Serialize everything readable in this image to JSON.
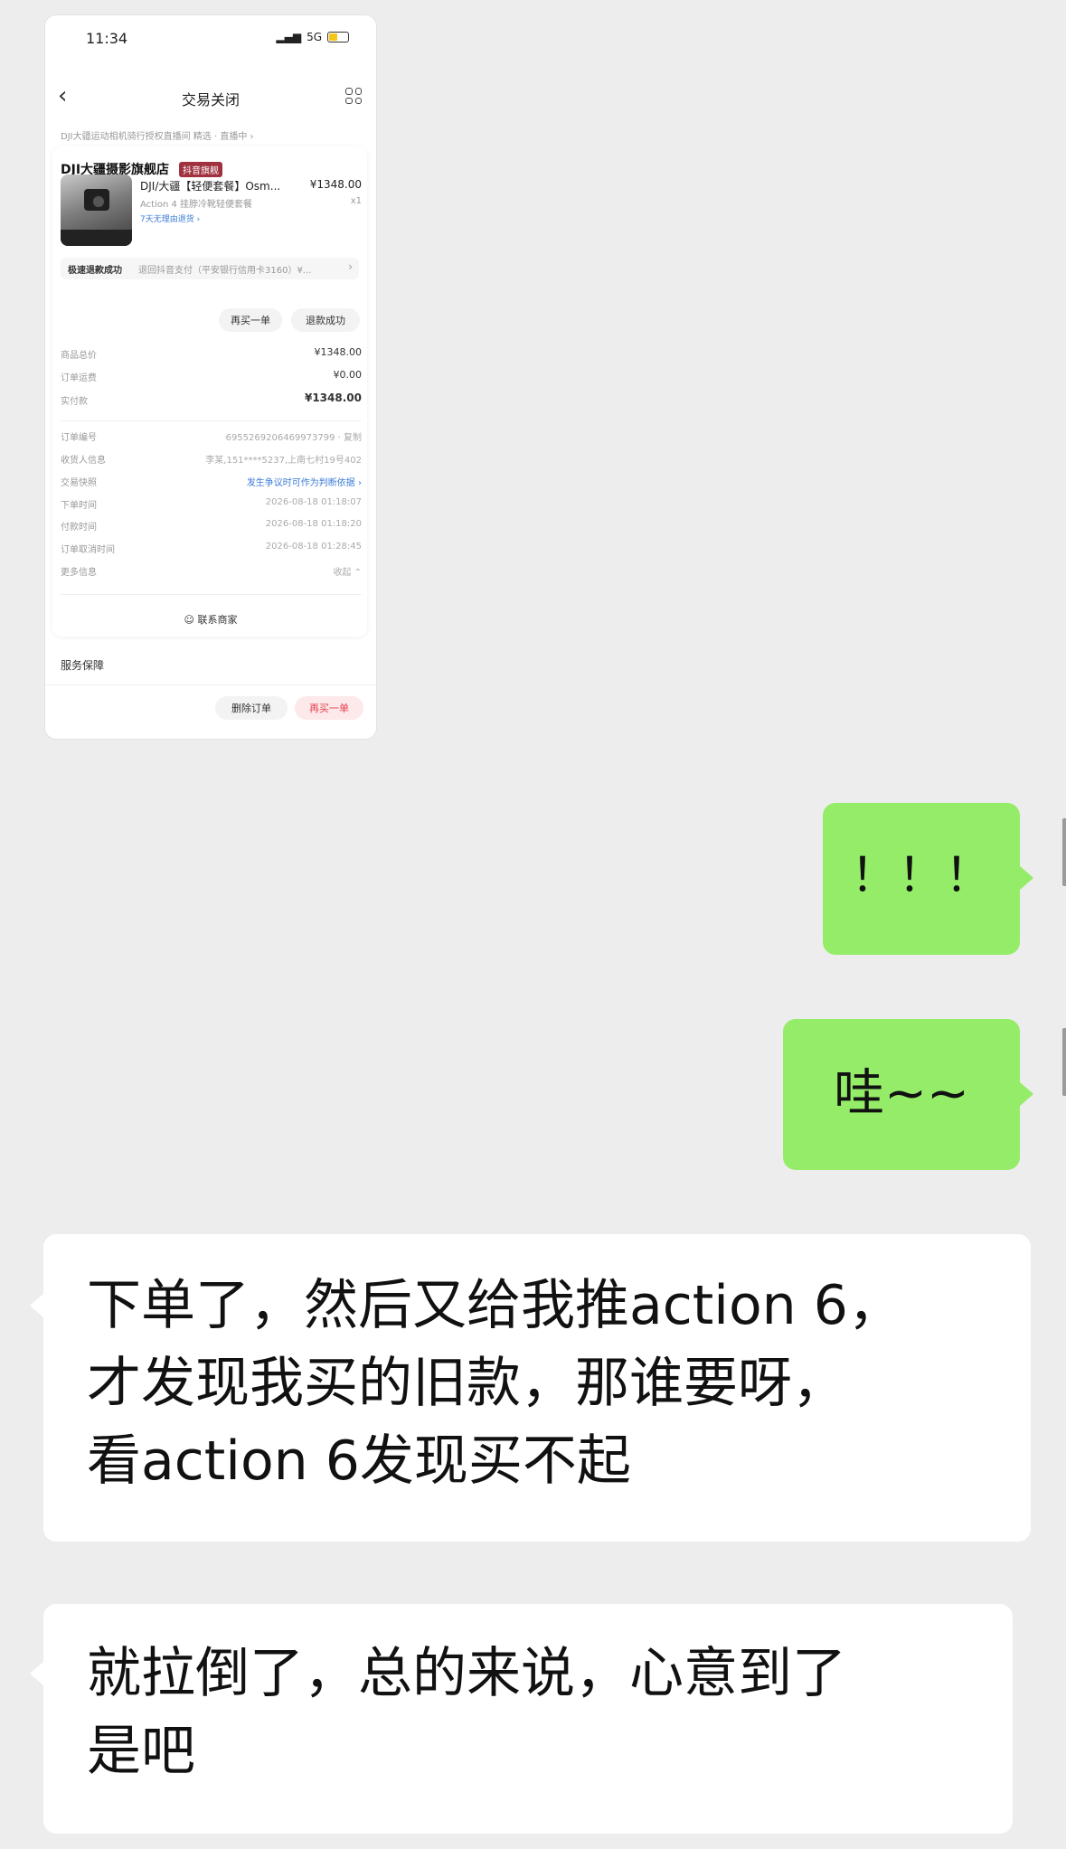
{
  "screenshot": {
    "status_bar": {
      "time": "11:34",
      "network": "5G"
    },
    "nav": {
      "title": "交易关闭"
    },
    "breadcrumb": "DJI大疆运动相机骑行授权直播间 精选 · 直播中 ›",
    "store": {
      "name": "DJI大疆摄影旗舰店",
      "badge": "抖音旗舰"
    },
    "product": {
      "name": "DJI/大疆【轻便套餐】Osm...",
      "price": "¥1348.00",
      "spec": "Action 4 挂脖冷靴轻便套餐",
      "quantity": "x1",
      "tag": "7天无理由退货 ›"
    },
    "refund": {
      "label": "极速退款成功",
      "text": "退回抖音支付（平安银行信用卡3160）¥...",
      "arrow": "›"
    },
    "buttons": {
      "buy_again": "再买一单",
      "refund_success": "退款成功",
      "delete_order": "删除订单",
      "buy_again_bottom": "再买一单"
    },
    "price_rows": [
      {
        "label": "商品总价",
        "value": "¥1348.00"
      },
      {
        "label": "订单运费",
        "value": "¥0.00"
      },
      {
        "label": "实付款",
        "value": "¥1348.00"
      }
    ],
    "info_rows": [
      {
        "label": "订单编号",
        "value": "6955269206469973799 · 复制"
      },
      {
        "label": "收货人信息",
        "value": "李某,151****5237,上南七村19号402"
      },
      {
        "label": "交易快照",
        "value": "发生争议时可作为判断依据 ›"
      },
      {
        "label": "下单时间",
        "value": "2026-08-18 01:18:07"
      },
      {
        "label": "付款时间",
        "value": "2026-08-18 01:18:20"
      },
      {
        "label": "订单取消时间",
        "value": "2026-08-18 01:28:45"
      },
      {
        "label": "更多信息",
        "value": "收起 ⌃"
      }
    ],
    "contact": "联系商家",
    "service": "服务保障"
  },
  "messages": [
    {
      "side": "right",
      "lines": [
        "！！！"
      ]
    },
    {
      "side": "right",
      "lines": [
        "哇~~"
      ]
    },
    {
      "side": "left",
      "lines": [
        "下单了，然后又给我推action 6，",
        "才发现我买的旧款，那谁要呀，",
        "看action 6发现买不起"
      ]
    },
    {
      "side": "left",
      "lines": [
        "就拉倒了，总的来说，心意到了",
        "是吧"
      ]
    }
  ],
  "colors": {
    "outgoing_bubble": "#95ec69",
    "incoming_bubble": "#ffffff",
    "chat_background": "#ededed"
  }
}
